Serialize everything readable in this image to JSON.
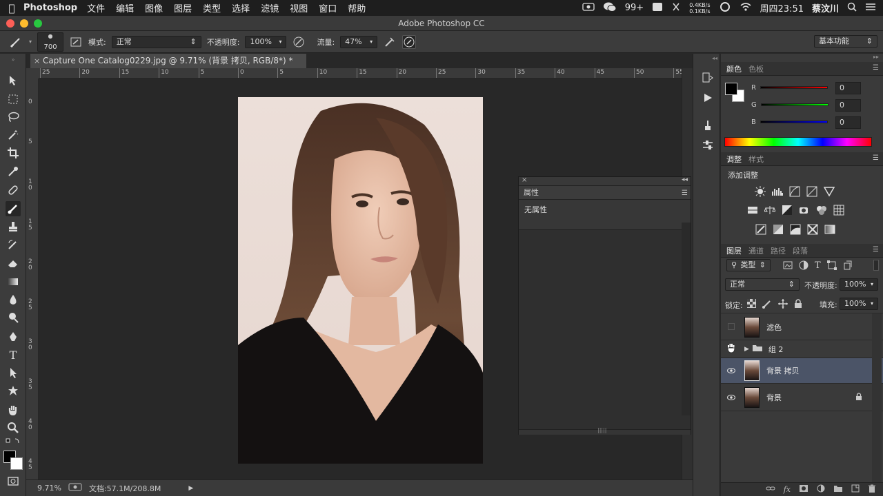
{
  "menubar": {
    "app_name": "Photoshop",
    "items": [
      "文件",
      "编辑",
      "图像",
      "图层",
      "类型",
      "选择",
      "滤镜",
      "视图",
      "窗口",
      "帮助"
    ],
    "notif_count": "99+",
    "net_up": "0.4KB/s",
    "net_down": "0.1KB/s",
    "datetime": "周四23:51",
    "user": "蔡汶川"
  },
  "window": {
    "title": "Adobe Photoshop CC"
  },
  "options": {
    "brush_size": "700",
    "mode_label": "模式:",
    "mode_value": "正常",
    "opacity_label": "不透明度:",
    "opacity_value": "100%",
    "flow_label": "流量:",
    "flow_value": "47%",
    "workspace": "基本功能"
  },
  "document": {
    "tab_title": "Capture One Catalog0229.jpg @ 9.71% (背景 拷贝, RGB/8*) *",
    "ruler_h": [
      "25",
      "20",
      "15",
      "10",
      "5",
      "0",
      "5",
      "10",
      "15",
      "20",
      "25",
      "30",
      "35",
      "40",
      "45",
      "50",
      "55"
    ],
    "ruler_v": [
      "0",
      "5",
      "1 0",
      "1 5",
      "2 0",
      "2 5",
      "3 0",
      "3 5",
      "4 0",
      "4 5"
    ]
  },
  "status": {
    "zoom": "9.71%",
    "doc_info": "文档:57.1M/208.8M"
  },
  "properties_panel": {
    "tab": "属性",
    "body": "无属性"
  },
  "color_panel": {
    "tabs": [
      "颜色",
      "色板"
    ],
    "channels": [
      {
        "name": "R",
        "value": "0"
      },
      {
        "name": "G",
        "value": "0"
      },
      {
        "name": "B",
        "value": "0"
      }
    ]
  },
  "adjust_panel": {
    "tabs": [
      "调整",
      "样式"
    ],
    "heading": "添加调整"
  },
  "layers_panel": {
    "tabs": [
      "图层",
      "通道",
      "路径",
      "段落"
    ],
    "filter_kind": "类型",
    "blend_mode": "正常",
    "opacity_label": "不透明度:",
    "opacity_value": "100%",
    "lock_label": "锁定:",
    "fill_label": "填充:",
    "fill_value": "100%",
    "layers": [
      {
        "name": "滤色",
        "visible": false,
        "selected": false
      },
      {
        "name": "组 2",
        "visible": true,
        "selected": false,
        "group": true
      },
      {
        "name": "背景 拷贝",
        "visible": true,
        "selected": true
      },
      {
        "name": "背景",
        "visible": true,
        "selected": false,
        "locked": true
      }
    ]
  },
  "colors": {
    "selection": "#4b5467",
    "panel_bg": "#3a3a3a",
    "canvas_bg": "#282828"
  }
}
